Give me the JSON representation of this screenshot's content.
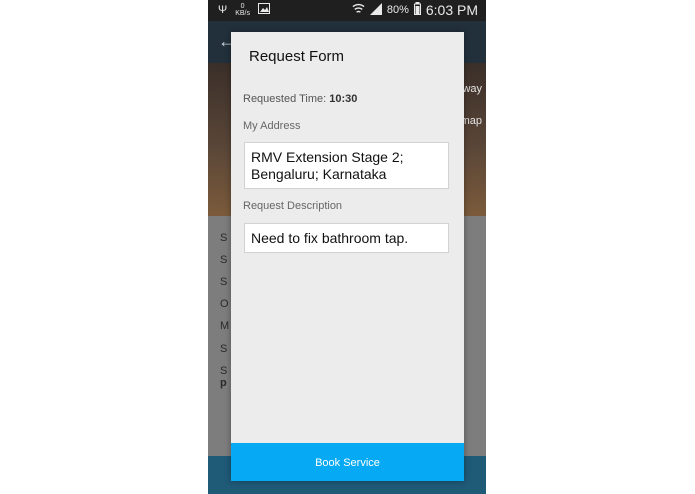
{
  "status_bar": {
    "kbs_value": "0",
    "kbs_unit": "KB/s",
    "battery": "80%",
    "time": "6:03 PM"
  },
  "background_app": {
    "hero_link_1": "way",
    "hero_link_2": "map",
    "list_stubs": [
      "S",
      "S",
      "S",
      "O",
      "M",
      "S",
      "S"
    ],
    "last_stub_bold": "p"
  },
  "dialog": {
    "title": "Request Form",
    "requested_time_label": "Requested Time:",
    "requested_time_value": "10:30",
    "address_label": "My Address",
    "address_value": "RMV Extension Stage 2; Bengaluru; Karnataka",
    "description_label": "Request Description",
    "description_value": "Need to fix bathroom tap.",
    "book_button": "Book Service"
  },
  "colors": {
    "accent": "#06a9f4",
    "dialog_bg": "#ececec"
  },
  "icons": [
    "usb-icon",
    "image-icon",
    "wifi-icon",
    "signal-icon",
    "battery-icon",
    "back-arrow-icon"
  ]
}
